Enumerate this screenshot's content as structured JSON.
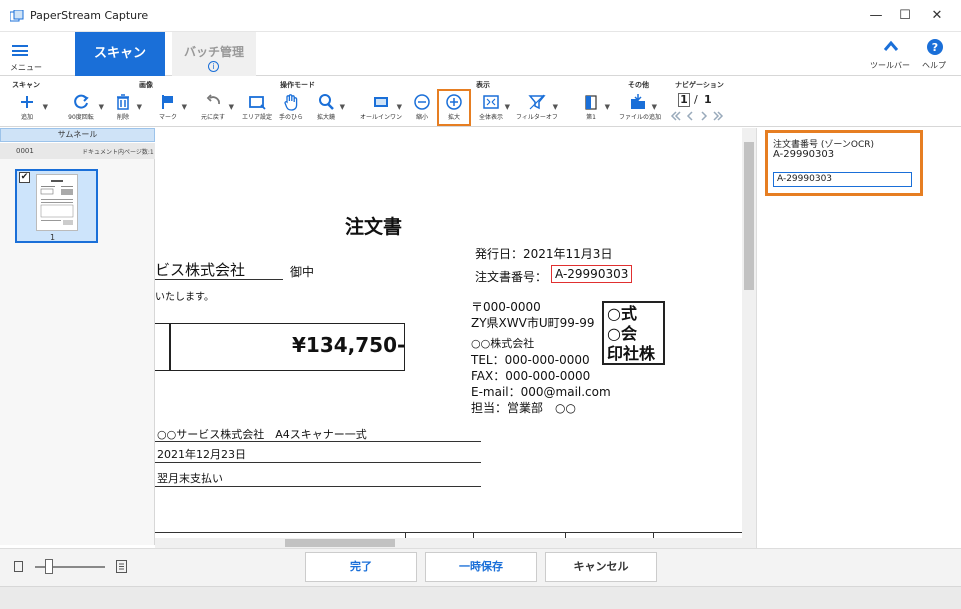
{
  "window": {
    "title": "PaperStream Capture",
    "minimize": "—",
    "maximize": "☐",
    "close": "✕"
  },
  "menu": {
    "label": "メニュー"
  },
  "tabs": {
    "scan": "スキャン",
    "batch": "バッチ管理",
    "batch_info": "i"
  },
  "topright": {
    "toolbar_label": "ツールバー",
    "help_label": "ヘルプ"
  },
  "ribbon": {
    "groups": {
      "scan": "スキャン",
      "image": "画像",
      "operation_mode": "操作モード",
      "display": "表示",
      "other": "その他",
      "navigation": "ナビゲーション"
    },
    "tools": {
      "add": "追加",
      "rotate": "90度回転",
      "delete": "削除",
      "mark": "マーク",
      "undo": "元に戻す",
      "area": "エリア設定",
      "hand": "手のひら",
      "magnifier": "拡大鏡",
      "all_in_one": "オールインワン",
      "zoom_out": "縮小",
      "zoom_in": "拡大",
      "fit_all": "全体表示",
      "filter_off": "フィルターオフ",
      "first": "第1",
      "file_add": "ファイルの追加"
    },
    "navigation": {
      "current": "1",
      "separator": "/",
      "total": "1"
    }
  },
  "thumbnails": {
    "header": "サムネール",
    "doc_id": "0001",
    "pages_label": "ドキュメント内ページ数:1",
    "page_num": "1",
    "checked": "✔"
  },
  "document": {
    "heading": "注文書",
    "customer": "ビス株式会社",
    "honorific": "御中",
    "greeting": "いたします。",
    "amount": "¥134,750-",
    "issue_date": "発行日：2021年11月3日",
    "order_label": "注文書番号：",
    "order_number": "A-29990303",
    "postal": "〒000-0000",
    "address": "ZY県XWV市U町99-99",
    "company": "○○株式会社",
    "tel": "TEL：000-000-0000",
    "fax": "FAX：000-000-0000",
    "email": "E-mail：000@mail.com",
    "contact": "担当：営業部　○○",
    "line1": "○○サービス株式会社　A4スキャナー一式",
    "line2": "2021年12月23日",
    "line3": "翌月末支払い",
    "seal_text": "○式\n○会\n印社株"
  },
  "ocr": {
    "label": "注文書番号 (ゾーンOCR)",
    "value": "A-29990303",
    "input_value": "A-29990303"
  },
  "buttons": {
    "done": "完了",
    "save": "一時保存",
    "cancel": "キャンセル"
  },
  "colors": {
    "accent": "#1a6fd8",
    "highlight": "#e67e22",
    "ocr_frame": "#e03030"
  }
}
